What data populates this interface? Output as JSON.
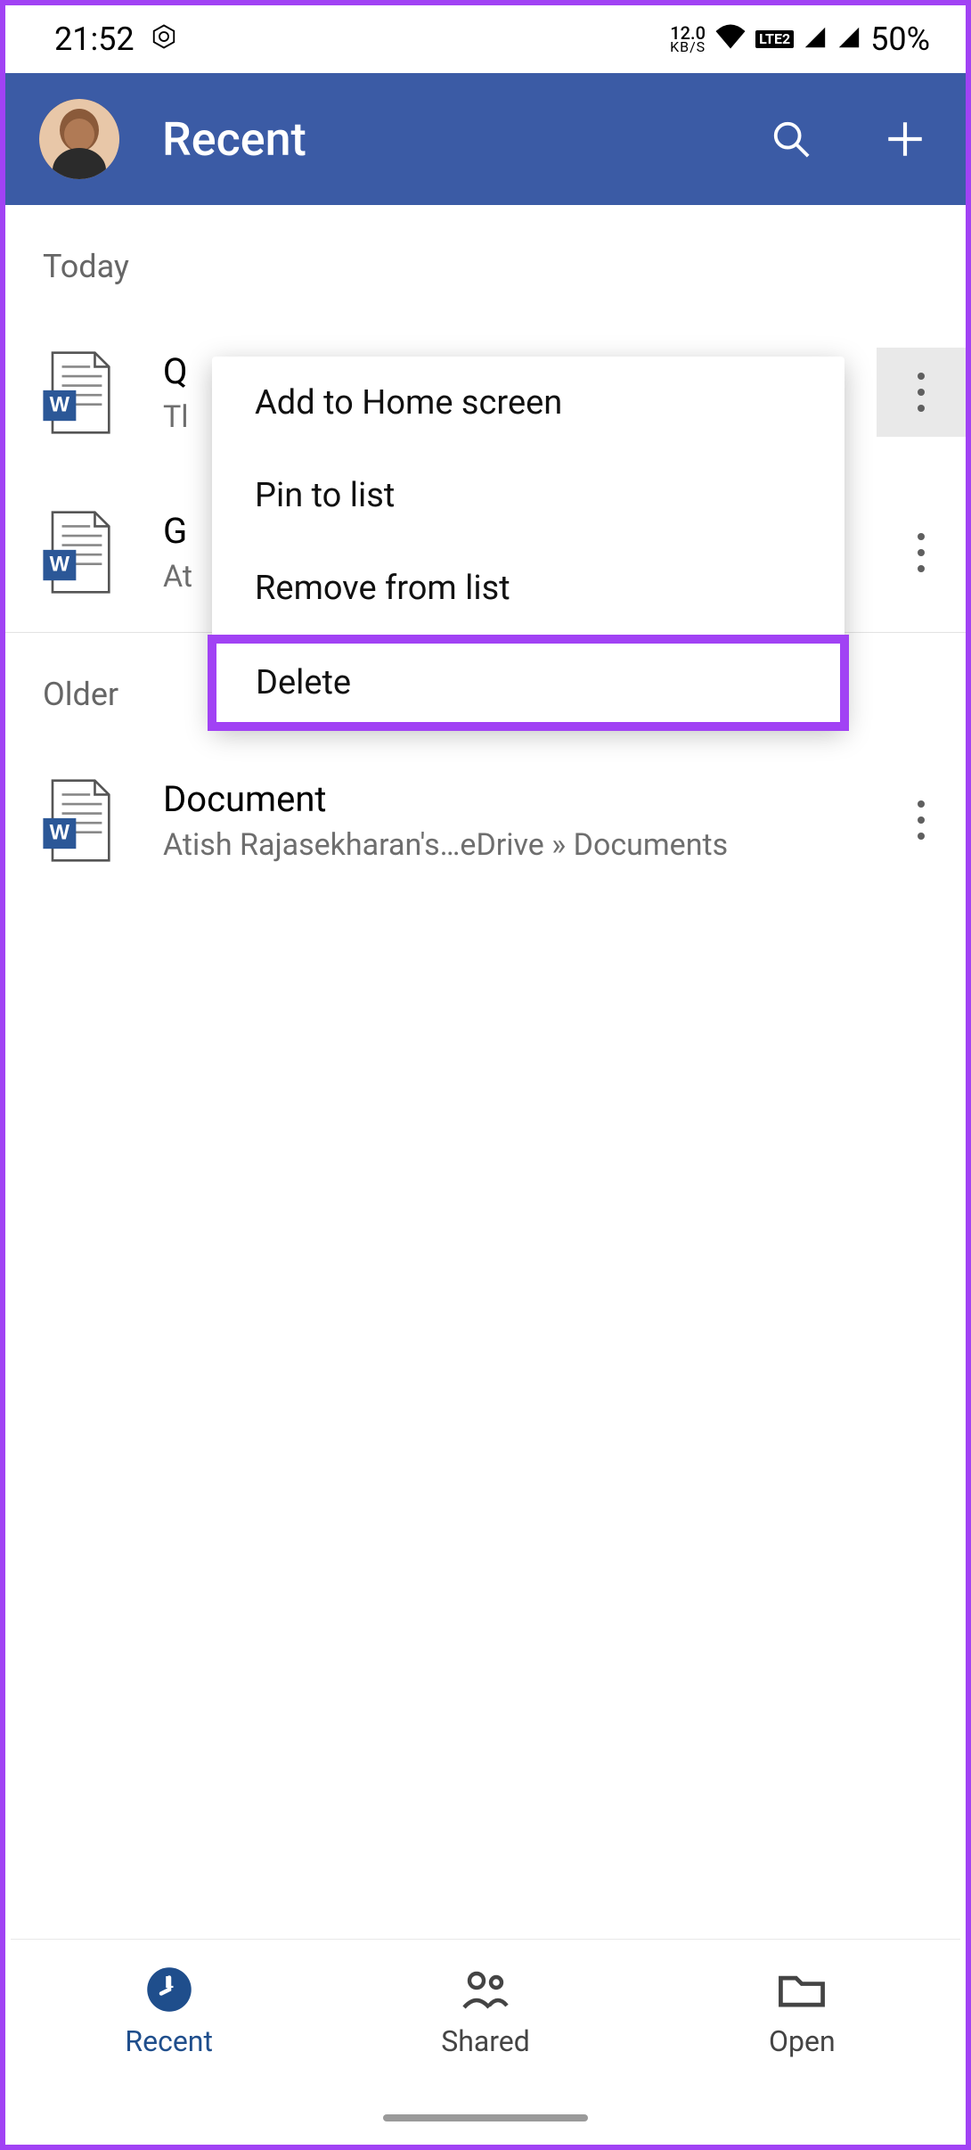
{
  "status": {
    "time": "21:52",
    "kbs_top": "12.0",
    "kbs_bot": "KB/S",
    "volte": "LTE2",
    "battery": "50%"
  },
  "header": {
    "title": "Recent"
  },
  "sections": {
    "today_label": "Today",
    "older_label": "Older"
  },
  "files": {
    "today": [
      {
        "title": "Q",
        "sub": "Tl"
      },
      {
        "title": "G",
        "sub": "At"
      }
    ],
    "older": [
      {
        "title": "Document",
        "sub": "Atish Rajasekharan's…eDrive » Documents"
      }
    ]
  },
  "popup": {
    "add_home": "Add to Home screen",
    "pin": "Pin to list",
    "remove": "Remove from list",
    "delete": "Delete"
  },
  "nav": {
    "recent": "Recent",
    "shared": "Shared",
    "open": "Open"
  }
}
